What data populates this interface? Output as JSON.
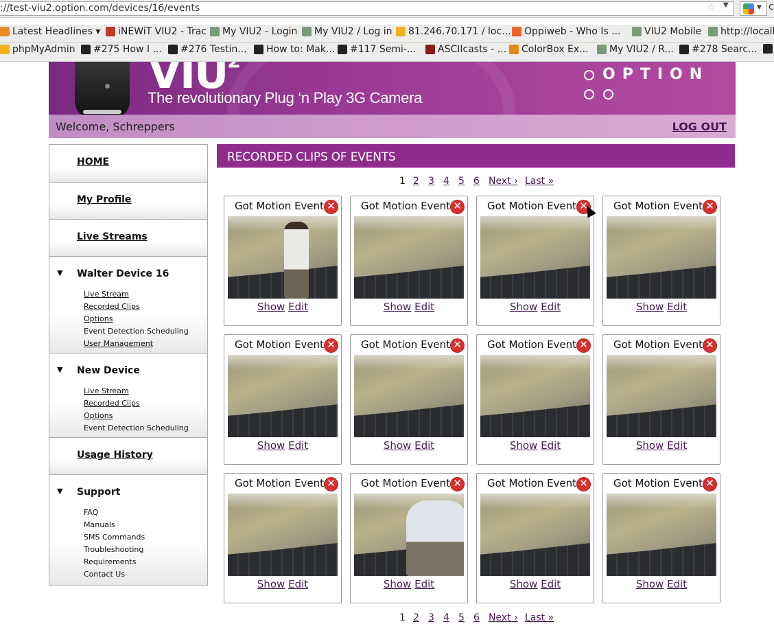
{
  "browser": {
    "url": "://test-viu2.option.com/devices/16/events",
    "search_cut": "c",
    "bookmarks_row1": [
      {
        "label": "Latest Headlines ▾",
        "icon": "rss-icon",
        "color": "#f08a24"
      },
      {
        "label": "iNEWiT VIU2 - Trac",
        "icon": "trac-icon",
        "color": "#c0392b"
      },
      {
        "label": "My VIU2 - Login",
        "icon": "page-icon",
        "color": "#7a9a7a"
      },
      {
        "label": "My VIU2 / Log in",
        "icon": "page-icon",
        "color": "#7a9a7a"
      },
      {
        "label": "81.246.70.171 / loc...",
        "icon": "pma-icon",
        "color": "#f2b21c"
      },
      {
        "label": "Oppiweb - Who Is ...",
        "icon": "joomla-icon",
        "color": "#e9632a"
      },
      {
        "label": "VIU2 Mobile",
        "icon": "page-icon",
        "color": "#7a9a7a"
      },
      {
        "label": "http://localh",
        "icon": "page-icon",
        "color": "#7a9a7a"
      }
    ],
    "bookmarks_row2": [
      {
        "label": "phpMyAdmin",
        "icon": "pma-icon",
        "color": "#f2b21c"
      },
      {
        "label": "#275 How I ...",
        "icon": "railscasts-icon",
        "color": "#222"
      },
      {
        "label": "#276 Testin...",
        "icon": "railscasts-icon",
        "color": "#222"
      },
      {
        "label": "How to: Mak...",
        "icon": "github-icon",
        "color": "#222"
      },
      {
        "label": "#117 Semi-...",
        "icon": "railscasts-icon",
        "color": "#222"
      },
      {
        "label": "ASCIIcasts - ...",
        "icon": "asciicasts-icon",
        "color": "#8b1a1a"
      },
      {
        "label": "ColorBox Ex...",
        "icon": "colorbox-icon",
        "color": "#e08a1a"
      },
      {
        "label": "My VIU2 / R...",
        "icon": "page-icon",
        "color": "#7a9a7a"
      },
      {
        "label": "#278 Searc...",
        "icon": "railscasts-icon",
        "color": "#222"
      },
      {
        "label": "",
        "icon": "github-icon",
        "color": "#222"
      }
    ]
  },
  "header": {
    "logo": "VIU",
    "logo_sup": "2",
    "tagline": "The revolutionary Plug ‘n Play 3G Camera",
    "brand": "OPTION",
    "welcome": "Welcome, Schreppers",
    "logout": "LOG OUT"
  },
  "sidebar": {
    "home": "HOME",
    "profile": "My Profile",
    "live_streams": "Live Streams",
    "device1": {
      "title": "Walter Device 16",
      "links": [
        {
          "label": "Live Stream",
          "u": true
        },
        {
          "label": "Recorded Clips",
          "u": true
        },
        {
          "label": "Options",
          "u": true
        },
        {
          "label": "Event Detection Scheduling",
          "u": false
        },
        {
          "label": "User Management",
          "u": true
        }
      ]
    },
    "device2": {
      "title": "New Device",
      "links": [
        {
          "label": "Live Stream",
          "u": true
        },
        {
          "label": "Recorded Clips",
          "u": true
        },
        {
          "label": "Options",
          "u": true
        },
        {
          "label": "Event Detection Scheduling",
          "u": false
        }
      ]
    },
    "usage": "Usage History",
    "support": {
      "title": "Support",
      "links": [
        "FAQ",
        "Manuals",
        "SMS Commands",
        "Troubleshooting",
        "Requirements",
        "Contact Us"
      ]
    }
  },
  "content": {
    "title": "RECORDED CLIPS OF EVENTS",
    "pager": {
      "current": "1",
      "pages": [
        "2",
        "3",
        "4",
        "5",
        "6"
      ],
      "next": "Next ›",
      "last": "Last »"
    },
    "clips": [
      {
        "title": "Got Motion Event",
        "person": "white-hoodie-walking"
      },
      {
        "title": "Got Motion Event",
        "person": ""
      },
      {
        "title": "Got Motion Event",
        "person": ""
      },
      {
        "title": "Got Motion Event",
        "person": ""
      },
      {
        "title": "Got Motion Event",
        "person": ""
      },
      {
        "title": "Got Motion Event",
        "person": ""
      },
      {
        "title": "Got Motion Event",
        "person": ""
      },
      {
        "title": "Got Motion Event",
        "person": ""
      },
      {
        "title": "Got Motion Event",
        "person": ""
      },
      {
        "title": "Got Motion Event",
        "person": "hoodie-close"
      },
      {
        "title": "Got Motion Event",
        "person": ""
      },
      {
        "title": "Got Motion Event",
        "person": ""
      }
    ],
    "show_label": "Show",
    "edit_label": "Edit",
    "delete_glyph": "✕"
  }
}
